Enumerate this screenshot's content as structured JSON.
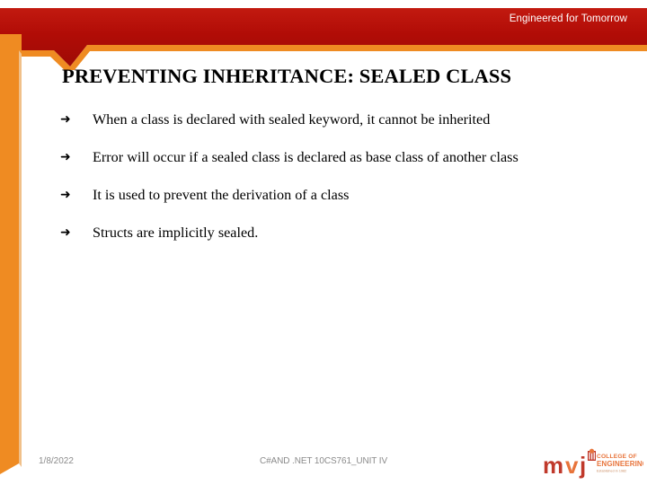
{
  "slide": {
    "title": "PREVENTING INHERITANCE: SEALED CLASS",
    "bullet_marker": "➜",
    "bullets": [
      {
        "text": "When a class is declared with sealed keyword, it cannot be inherited",
        "justified": false
      },
      {
        "text": "Error will occur if a sealed class is declared as base class of another class",
        "justified": true
      },
      {
        "text": "It is used to prevent the derivation of a class",
        "justified": false
      },
      {
        "text": "Structs are implicitly sealed.",
        "justified": false
      }
    ]
  },
  "header": {
    "tagline": "Engineered for Tomorrow",
    "band_color": "#b10c06",
    "accent_color": "#ef8b22"
  },
  "sidebar": {
    "color": "#ef8b22",
    "edge_color": "#f0c08a"
  },
  "footer": {
    "date": "1/8/2022",
    "center_text": "C#AND .NET 10CS761_UNIT IV",
    "text_color": "#8b8b8b"
  },
  "logo": {
    "wordmark": "mvj",
    "line1": "COLLEGE OF",
    "line2": "ENGINEERING",
    "tagline": "Established in 1982",
    "m_color": "#c0392b",
    "v_color": "#e8743b",
    "j_color": "#c0392b",
    "text_color": "#e8743b"
  }
}
